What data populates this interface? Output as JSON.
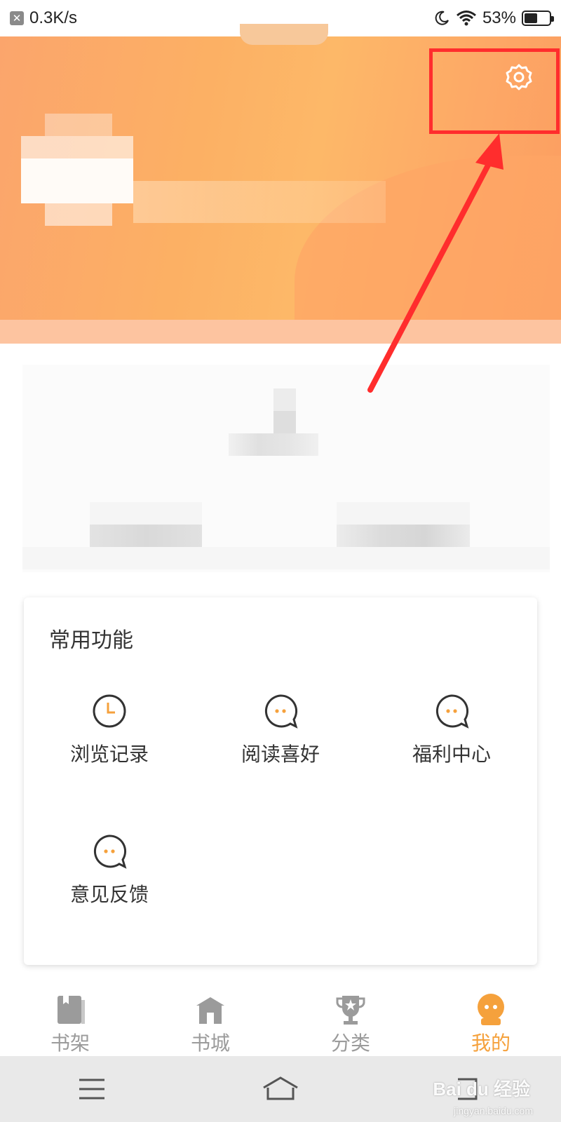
{
  "status_bar": {
    "network_speed": "0.3K/s",
    "battery_percent": "53%",
    "battery_level": 0.53,
    "icons": [
      "close-badge-icon",
      "moon-icon",
      "wifi-icon",
      "battery-icon"
    ]
  },
  "header": {
    "settings_icon": "gear-icon",
    "colors": {
      "banner": "#fdb067",
      "annotation": "#ff2d2d"
    }
  },
  "common_functions": {
    "title": "常用功能",
    "items": [
      {
        "label": "浏览记录",
        "icon": "clock-icon"
      },
      {
        "label": "阅读喜好",
        "icon": "chat-bubble-icon"
      },
      {
        "label": "福利中心",
        "icon": "chat-bubble-icon"
      },
      {
        "label": "意见反馈",
        "icon": "chat-bubble-icon"
      }
    ]
  },
  "tab_bar": {
    "tabs": [
      {
        "label": "书架",
        "icon": "book-icon",
        "active": false
      },
      {
        "label": "书城",
        "icon": "store-icon",
        "active": false
      },
      {
        "label": "分类",
        "icon": "trophy-icon",
        "active": false
      },
      {
        "label": "我的",
        "icon": "face-icon",
        "active": true
      }
    ],
    "colors": {
      "active": "#f5a13c",
      "inactive": "#9b9b9b"
    }
  },
  "system_nav": {
    "icons": [
      "menu-icon",
      "home-icon",
      "back-icon"
    ]
  },
  "watermark": {
    "brand": "Bai du 经验",
    "url": "jingyan.baidu.com"
  }
}
